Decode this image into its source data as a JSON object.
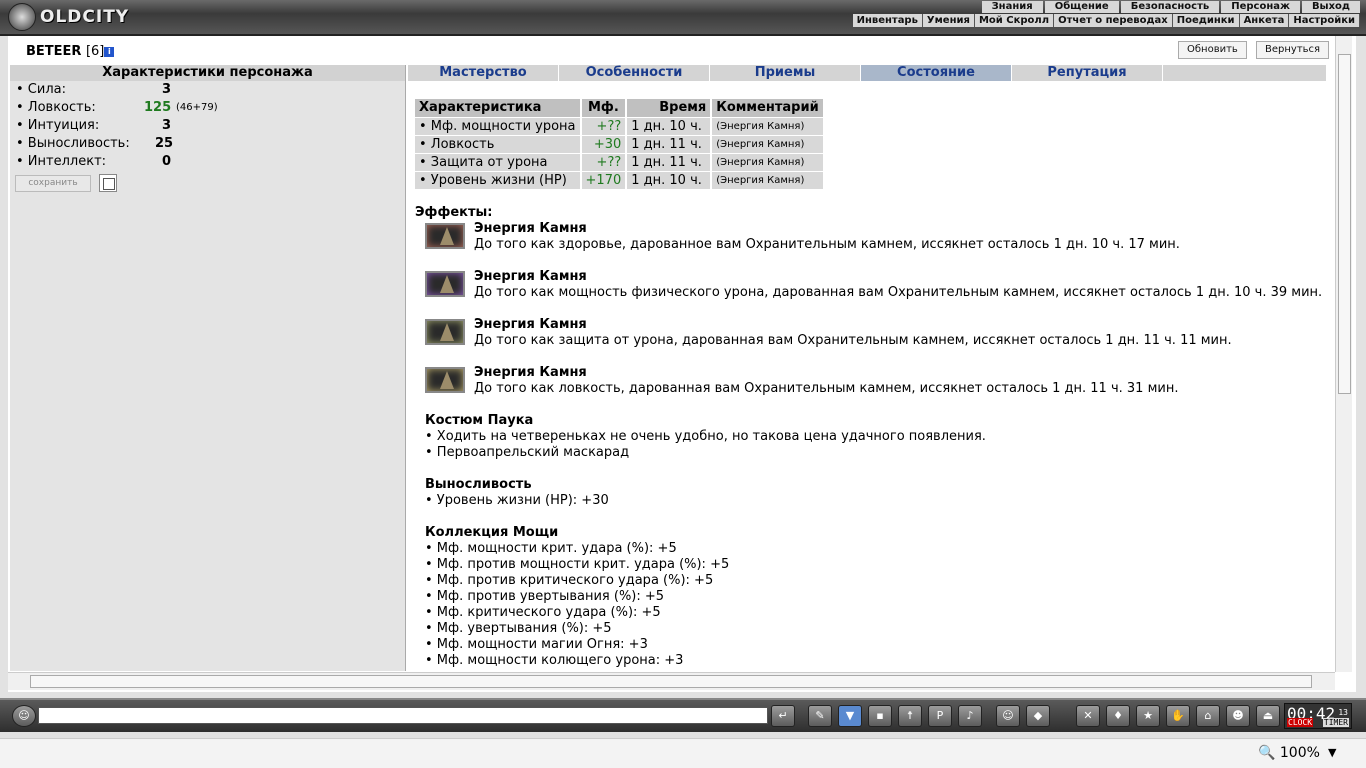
{
  "header": {
    "logo_text": "OLDCITY",
    "menu": [
      "Знания",
      "Общение",
      "Безопасность",
      "Персонаж",
      "Выход"
    ],
    "submenu": [
      "Инвентарь",
      "Умения",
      "Мой Скролл",
      "Отчет о переводах",
      "Поединки",
      "Анкета",
      "Настройки"
    ]
  },
  "character": {
    "name": "BETEER",
    "level": "[6]",
    "info_icon": "i"
  },
  "buttons": {
    "refresh": "Обновить",
    "back": "Вернуться"
  },
  "left": {
    "title": "Характеристики персонажа",
    "stats": [
      {
        "label": "• Сила:",
        "value": "3",
        "extra": ""
      },
      {
        "label": "• Ловкость:",
        "value": "125",
        "extra": "(46+79)"
      },
      {
        "label": "• Интуиция:",
        "value": "3",
        "extra": ""
      },
      {
        "label": "• Выносливость:",
        "value": "25",
        "extra": ""
      },
      {
        "label": "• Интеллект:",
        "value": "0",
        "extra": ""
      }
    ],
    "save": "сохранить"
  },
  "tabs": [
    "Мастерство",
    "Особенности",
    "Приемы",
    "Состояние",
    "Репутация"
  ],
  "active_tab": 3,
  "table": {
    "headers": [
      "Характеристика",
      "Мф.",
      "Время",
      "Комментарий"
    ],
    "rows": [
      [
        "• Мф. мощности урона",
        "+??",
        "1 дн. 10 ч.",
        "(Энергия Камня)"
      ],
      [
        "• Ловкость",
        "+30",
        "1 дн. 11 ч.",
        "(Энергия Камня)"
      ],
      [
        "• Защита от урона",
        "+??",
        "1 дн. 11 ч.",
        "(Энергия Камня)"
      ],
      [
        "• Уровень жизни (HP)",
        "+170",
        "1 дн. 10 ч.",
        "(Энергия Камня)"
      ]
    ]
  },
  "effects": {
    "heading": "Эффекты:",
    "items": [
      {
        "title": "Энергия Камня",
        "desc": "До того как здоровье, дарованное вам Охранительным камнем, иссякнет осталось 1 дн. 10 ч. 17 мин.",
        "color": "#b06a5a"
      },
      {
        "title": "Энергия Камня",
        "desc": "До того как мощность физического урона, дарованная вам Охранительным камнем, иссякнет осталось 1 дн. 10 ч. 39 мин.",
        "color": "#8a5ab8"
      },
      {
        "title": "Энергия Камня",
        "desc": "До того как защита от урона, дарованная вам Охранительным камнем, иссякнет осталось 1 дн. 11 ч. 11 мин.",
        "color": "#9ca06a"
      },
      {
        "title": "Энергия Камня",
        "desc": "До того как ловкость, дарованная вам Охранительным камнем, иссякнет осталось 1 дн. 11 ч. 31 мин.",
        "color": "#b8a86a"
      }
    ]
  },
  "groups": [
    {
      "title": "Костюм Паука",
      "lines": [
        "• Ходить на четвереньках не очень удобно, но такова цена удачного появления.",
        "• Первоапрельский маскарад"
      ]
    },
    {
      "title": "Выносливость",
      "lines": [
        "• Уровень жизни (HP): +30"
      ]
    },
    {
      "title": "Коллекция Мощи",
      "lines": [
        "• Мф. мощности крит. удара (%): +5",
        "• Мф. против мощности крит. удара (%): +5",
        "• Мф. против критического удара (%): +5",
        "• Мф. против увертывания (%): +5",
        "• Мф. критического удара (%): +5",
        "• Мф. увертывания (%): +5",
        "• Мф. мощности магии Огня: +3",
        "• Мф. мощности колющего урона: +3"
      ]
    }
  ],
  "clock": {
    "time": "00:42",
    "sec": "13",
    "clock_label": "CLOCK",
    "timer_label": "TIMER"
  },
  "status": {
    "zoom": "100%"
  }
}
